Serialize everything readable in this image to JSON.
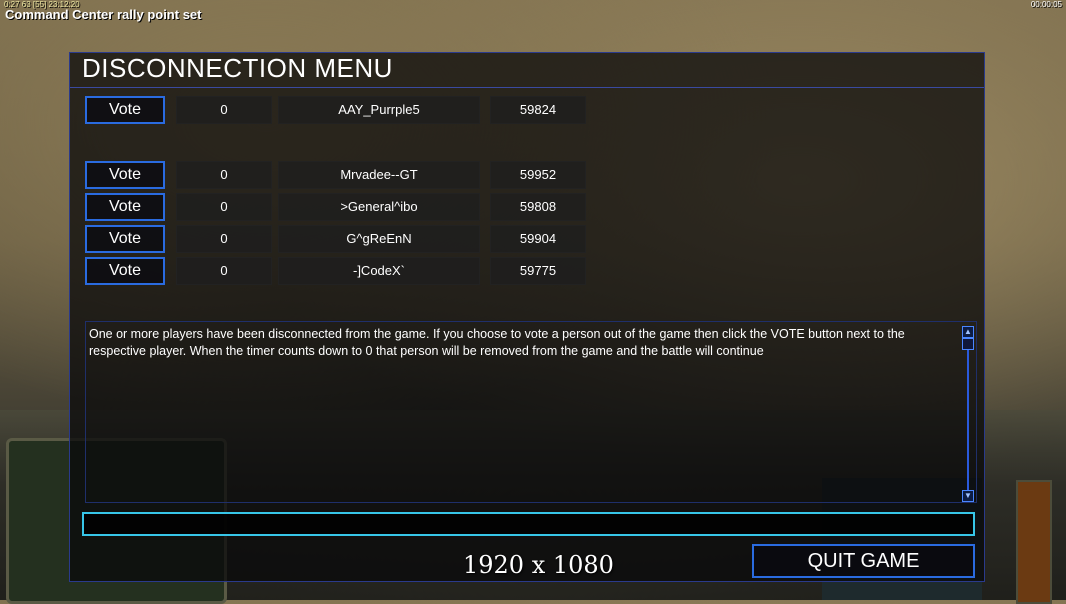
{
  "hud": {
    "status_message": "Command Center rally point set",
    "top_left_info": "0:27 63 [55] 23:12:20",
    "clock": "00:00:05",
    "overlay_resolution": "1920 x 1080"
  },
  "dialog": {
    "title": "DISCONNECTION MENU",
    "vote_label": "Vote",
    "players": [
      {
        "votes": "0",
        "name": "AAY_Purrple5",
        "ping": "59824"
      },
      {
        "votes": "0",
        "name": "Mrvadee--GT",
        "ping": "59952"
      },
      {
        "votes": "0",
        "name": ">General^ibo",
        "ping": "59808"
      },
      {
        "votes": "0",
        "name": "G^gReEnN",
        "ping": "59904"
      },
      {
        "votes": "0",
        "name": "-]CodeX`",
        "ping": "59775"
      }
    ],
    "message": "One or more players have been disconnected from the game. If you choose to vote a person out of the game then click the VOTE button next to the respective player. When the timer counts down to 0 that person will be removed from the game and the battle will continue",
    "chat_value": "",
    "quit_label": "QUIT GAME"
  },
  "colors": {
    "button_border": "#2a6be0",
    "chat_border": "#37c6e8",
    "dialog_border": "#2a3a8c"
  }
}
